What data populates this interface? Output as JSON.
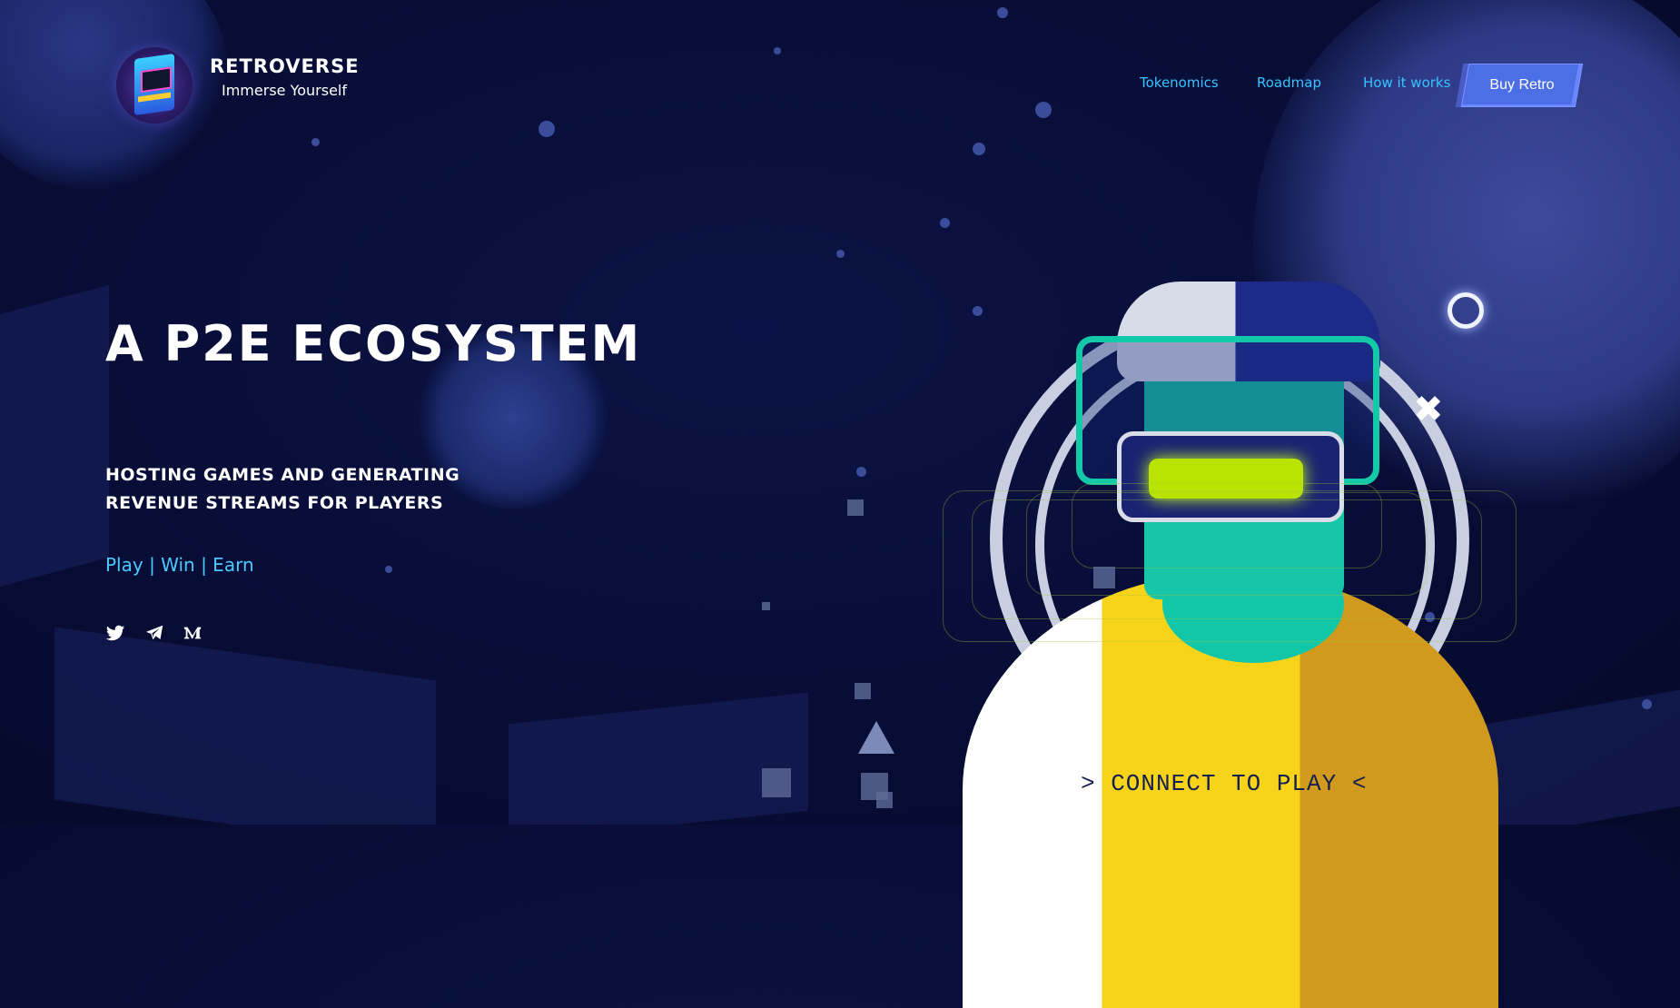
{
  "header": {
    "brand_title": "RETROVERSE",
    "brand_subtitle": "Immerse Yourself",
    "logo_icon": "arcade-cabinet-icon",
    "nav": [
      {
        "label": "Tokenomics"
      },
      {
        "label": "Roadmap"
      },
      {
        "label": "How it works"
      }
    ],
    "cta_label": "Buy Retro"
  },
  "hero": {
    "heading": "A P2E ECOSYSTEM",
    "tagline": "HOSTING GAMES AND GENERATING REVENUE STREAMS FOR PLAYERS",
    "play_win_earn": "Play | Win | Earn",
    "social": [
      {
        "icon": "twitter-icon"
      },
      {
        "icon": "telegram-icon"
      },
      {
        "icon": "medium-icon"
      }
    ],
    "connect_label": "> CONNECT TO PLAY <"
  },
  "colors": {
    "background": "#070d35",
    "accent_blue": "#37c3ff",
    "button": "#4c6fe6",
    "lens_green": "#b9e300",
    "yellow": "#f7d31a",
    "teal": "#16c6a7"
  }
}
